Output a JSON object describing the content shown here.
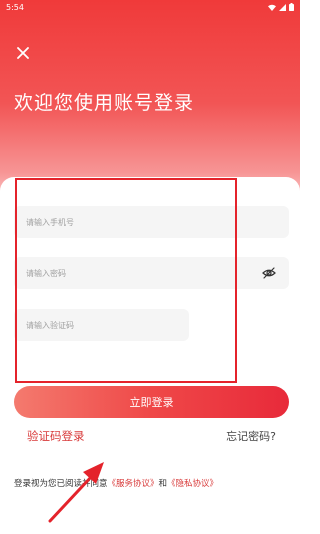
{
  "status_bar": {
    "time": "5:54",
    "icons": [
      "wifi-icon",
      "signal-icon",
      "battery-icon"
    ]
  },
  "header": {
    "close_icon": "close-icon",
    "title": "欢迎您使用账号登录"
  },
  "form": {
    "phone_placeholder": "请输入手机号",
    "password_placeholder": "请输入密码",
    "password_toggle_icon": "eye-off-icon",
    "captcha_placeholder": "请输入验证码",
    "login_label": "立即登录"
  },
  "links": {
    "sms_login": "验证码登录",
    "forgot_password": "忘记密码?"
  },
  "agreement": {
    "prefix": "登录视为您已阅读并同意",
    "service": "《服务协议》",
    "joiner": "和",
    "privacy": "《隐私协议》"
  },
  "colors": {
    "brand_red": "#ef3f3f",
    "link_red": "#d83a3a",
    "annotation_red": "#e4232b"
  }
}
